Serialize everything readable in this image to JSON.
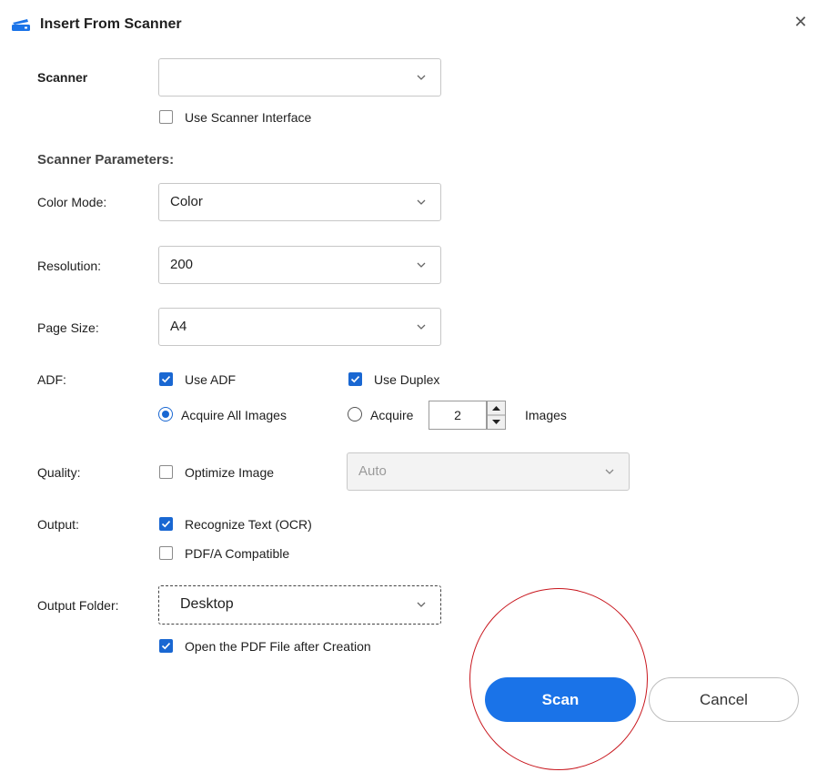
{
  "dialog": {
    "title": "Insert From Scanner",
    "close_glyph": "✕"
  },
  "scanner": {
    "label": "Scanner",
    "value": "",
    "use_interface_label": "Use Scanner Interface",
    "use_interface_checked": false
  },
  "params": {
    "heading": "Scanner Parameters:",
    "color_mode": {
      "label": "Color Mode:",
      "value": "Color"
    },
    "resolution": {
      "label": "Resolution:",
      "value": "200"
    },
    "page_size": {
      "label": "Page Size:",
      "value": "A4"
    }
  },
  "adf": {
    "label": "ADF:",
    "use_adf_label": "Use ADF",
    "use_adf_checked": true,
    "use_duplex_label": "Use Duplex",
    "use_duplex_checked": true,
    "acquire_all_label": "Acquire All Images",
    "acquire_label": "Acquire",
    "acquire_count": "2",
    "images_label": "Images",
    "selected_mode": "acquire_all"
  },
  "quality": {
    "label": "Quality:",
    "optimize_label": "Optimize Image",
    "optimize_checked": false,
    "level_value": "Auto"
  },
  "output": {
    "label": "Output:",
    "ocr_label": "Recognize Text (OCR)",
    "ocr_checked": true,
    "pdfa_label": "PDF/A Compatible",
    "pdfa_checked": false
  },
  "output_folder": {
    "label": "Output Folder:",
    "value": "Desktop",
    "open_after_label": "Open the PDF File after Creation",
    "open_after_checked": true
  },
  "buttons": {
    "scan": "Scan",
    "cancel": "Cancel"
  },
  "colors": {
    "accent": "#1a73e8",
    "checkbox": "#1967d2",
    "highlight": "#c8161d"
  },
  "icons": {
    "scanner": "scanner-icon",
    "close": "close-icon",
    "chevron": "chevron-down-icon"
  }
}
